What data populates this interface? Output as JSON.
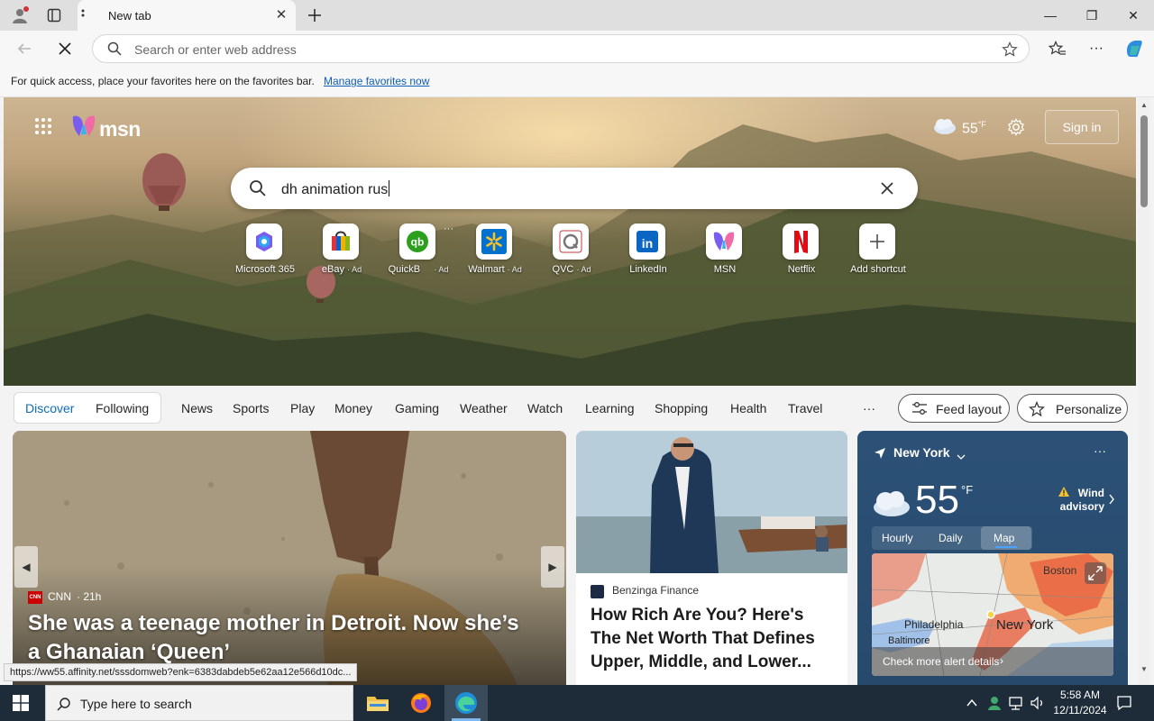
{
  "browser": {
    "tab_title": "New tab",
    "address_placeholder": "Search or enter web address",
    "favorites_bar_text": "For quick access, place your favorites here on the favorites bar.",
    "favorites_bar_link": "Manage favorites now"
  },
  "header": {
    "brand": "msn",
    "weather_temp": "55",
    "weather_unit": "°F",
    "sign_in": "Sign in"
  },
  "search": {
    "value": "dh animation rus"
  },
  "shortcuts": [
    {
      "label": "Microsoft 365",
      "ad": ""
    },
    {
      "label": "eBay",
      "ad": "· Ad"
    },
    {
      "label": "QuickB",
      "ad": "· Ad"
    },
    {
      "label": "Walmart",
      "ad": "· Ad"
    },
    {
      "label": "QVC",
      "ad": "· Ad"
    },
    {
      "label": "LinkedIn",
      "ad": ""
    },
    {
      "label": "MSN",
      "ad": ""
    },
    {
      "label": "Netflix",
      "ad": ""
    },
    {
      "label": "Add shortcut",
      "ad": ""
    }
  ],
  "nav": {
    "discover": "Discover",
    "following": "Following",
    "links": [
      "News",
      "Sports",
      "Play",
      "Money",
      "Gaming",
      "Weather",
      "Watch",
      "Learning",
      "Shopping",
      "Health",
      "Travel"
    ],
    "more": "···",
    "feed_layout": "Feed layout",
    "personalize": "Personalize"
  },
  "hero_card": {
    "source_badge": "CNN",
    "source": "CNN",
    "age": "· 21h",
    "title": "She was a teenage mother in Detroit. Now she’s a Ghanaian ‘Queen’"
  },
  "card2": {
    "source": "Benzinga Finance",
    "title": "How Rich Are You? Here's The Net Worth That Defines Upper, Middle, and Lower..."
  },
  "weather": {
    "city": "New York",
    "temp": "55",
    "unit": "°F",
    "alert_line1": "Wind",
    "alert_line2": "advisory",
    "tabs": [
      "Hourly",
      "Daily",
      "Map"
    ],
    "active_tab": "Map",
    "map_labels": [
      "Boston",
      "Philadelphia",
      "New York",
      "Baltimore"
    ],
    "more_details": "Check more alert details"
  },
  "status_url": "https://ww55.affinity.net/sssdomweb?enk=6383dabdeb5e62aa12e566d10dc...",
  "taskbar": {
    "search_placeholder": "Type here to search",
    "time": "5:58 AM",
    "date": "12/11/2024"
  },
  "colors": {
    "accent": "#0f6cbd",
    "taskbar_bg": "#1e2b38",
    "weather_card_bg": "#2c5177"
  }
}
